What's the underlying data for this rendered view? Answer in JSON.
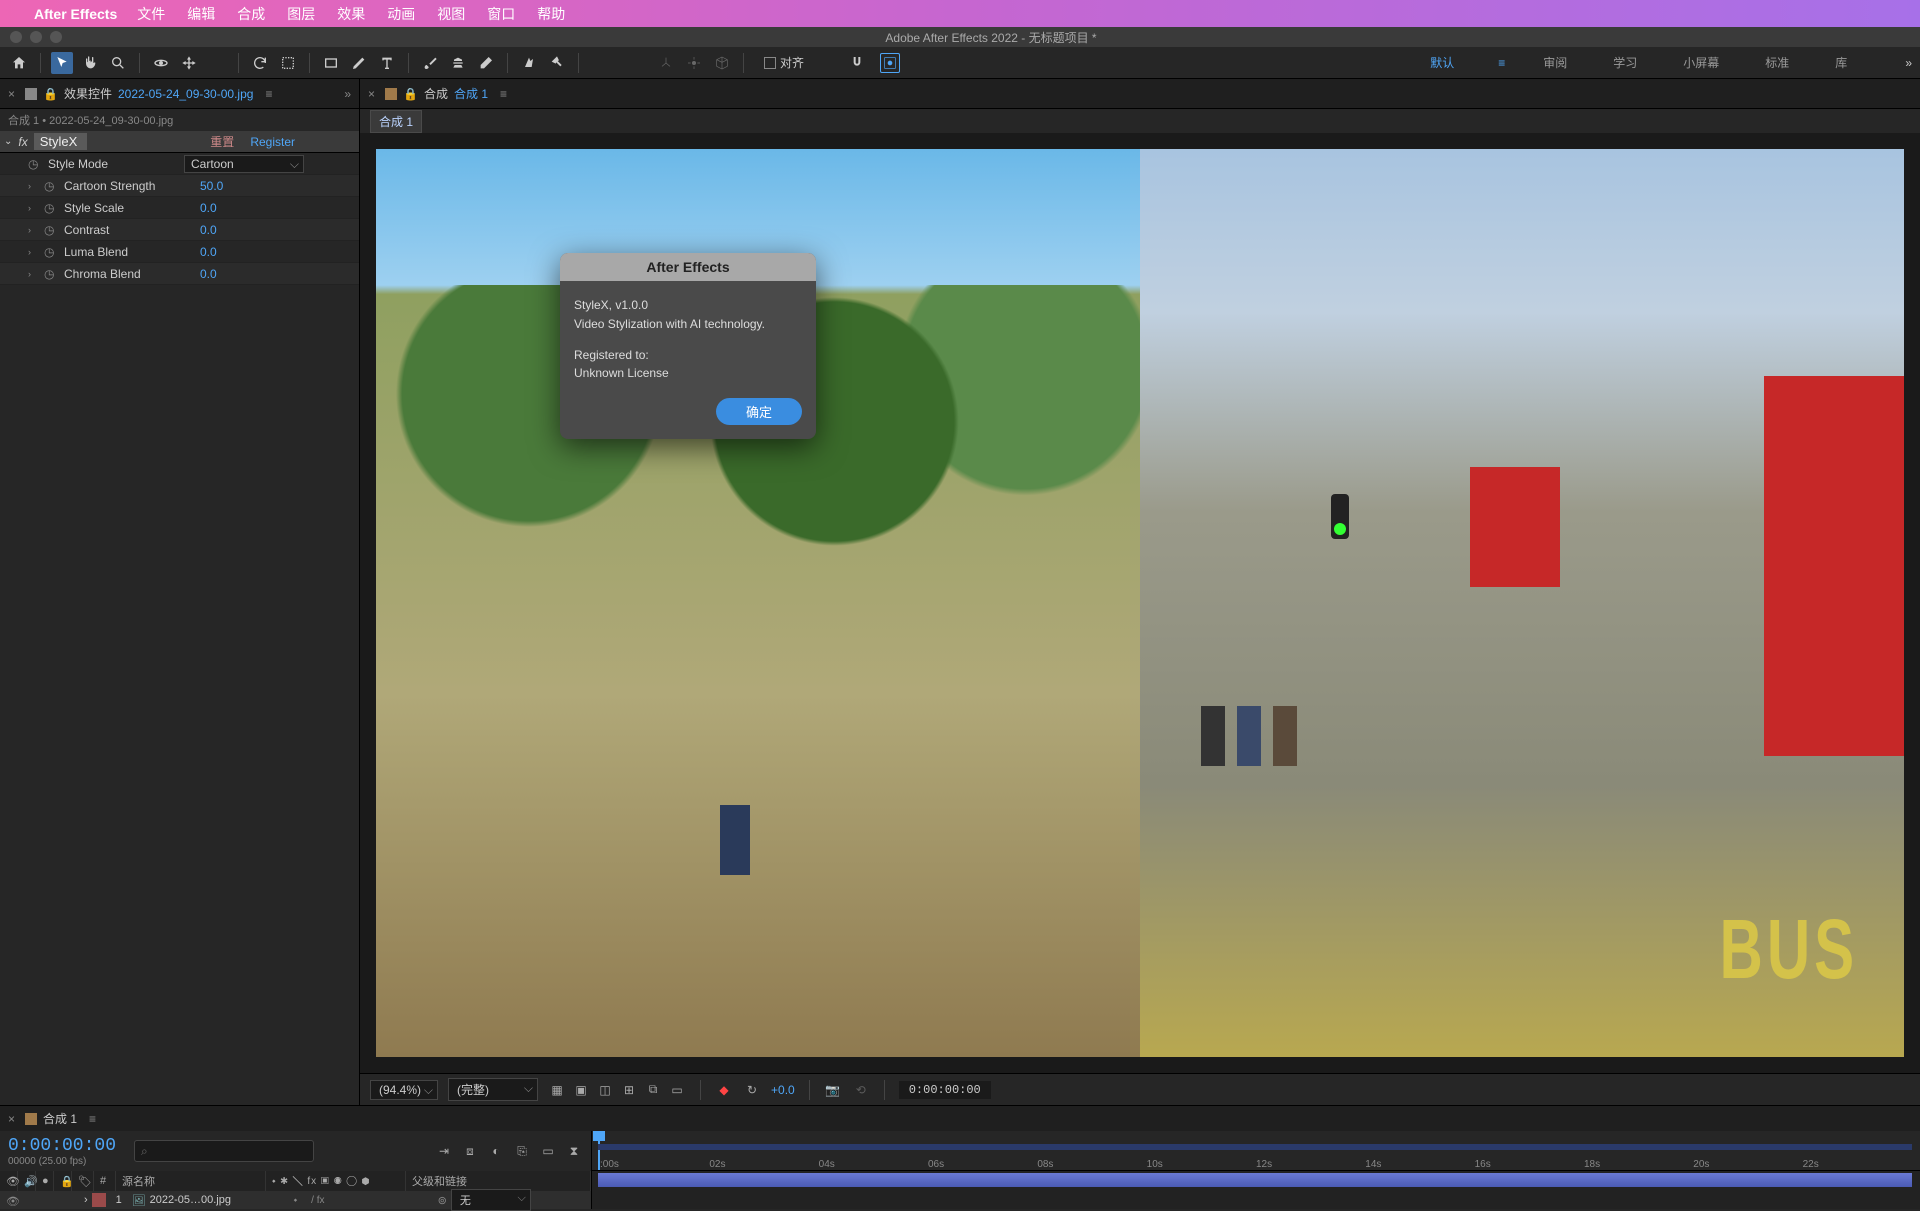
{
  "mac_menu": {
    "app_name": "After Effects",
    "items": [
      "文件",
      "编辑",
      "合成",
      "图层",
      "效果",
      "动画",
      "视图",
      "窗口",
      "帮助"
    ]
  },
  "window": {
    "title": "Adobe After Effects 2022 - 无标题项目 *"
  },
  "toolbar": {
    "align_label": "对齐"
  },
  "workspaces": [
    "默认",
    "审阅",
    "学习",
    "小屏幕",
    "标准",
    "库"
  ],
  "effect_controls": {
    "tab_label": "效果控件",
    "tab_file": "2022-05-24_09-30-00.jpg",
    "breadcrumb": "合成 1 • 2022-05-24_09-30-00.jpg",
    "fx_name": "StyleX",
    "reset_label": "重置",
    "register_label": "Register",
    "props": [
      {
        "name": "Style Mode",
        "value": "Cartoon",
        "type": "enum"
      },
      {
        "name": "Cartoon Strength",
        "value": "50.0",
        "type": "num"
      },
      {
        "name": "Style Scale",
        "value": "0.0",
        "type": "num"
      },
      {
        "name": "Contrast",
        "value": "0.0",
        "type": "num"
      },
      {
        "name": "Luma Blend",
        "value": "0.0",
        "type": "num"
      },
      {
        "name": "Chroma Blend",
        "value": "0.0",
        "type": "num"
      }
    ]
  },
  "composition": {
    "tab_prefix": "合成",
    "tab_name": "合成 1",
    "flowchart": "合成 1"
  },
  "dialog": {
    "title": "After Effects",
    "line1": "StyleX, v1.0.0",
    "line2": "Video Stylization with AI technology.",
    "reg_label": "Registered to:",
    "reg_value": " Unknown License",
    "ok": "确定"
  },
  "viewer_footer": {
    "zoom": "(94.4%)",
    "res": "(完整)",
    "exposure": "+0.0",
    "timecode": "0:00:00:00"
  },
  "timeline": {
    "tab_name": "合成 1",
    "timecode": "0:00:00:00",
    "frame_info": "00000 (25.00 fps)",
    "col_source": "源名称",
    "col_parent": "父级和链接",
    "layer_index": "1",
    "layer_name": "2022-05…00.jpg",
    "parent_value": "无",
    "ticks": [
      ":00s",
      "02s",
      "04s",
      "06s",
      "08s",
      "10s",
      "12s",
      "14s",
      "16s",
      "18s",
      "20s",
      "22s"
    ]
  },
  "scene_text": {
    "bus": "BUS"
  }
}
